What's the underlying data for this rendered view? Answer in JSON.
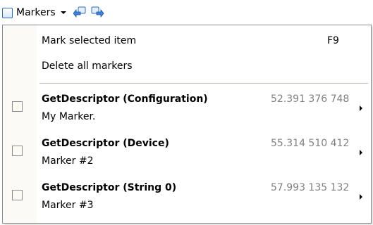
{
  "toolbar": {
    "label": "Markers",
    "icons": [
      "marker-icon",
      "prev-marker-icon",
      "next-marker-icon"
    ]
  },
  "menu": {
    "actions": [
      {
        "label": "Mark selected item",
        "shortcut": "F9"
      },
      {
        "label": "Delete all markers",
        "shortcut": ""
      }
    ],
    "markers": [
      {
        "name": "GetDescriptor (Configuration)",
        "note": "My Marker.",
        "time": "52.391 376 748"
      },
      {
        "name": "GetDescriptor (Device)",
        "note": "Marker #2",
        "time": "55.314 510 412"
      },
      {
        "name": "GetDescriptor (String 0)",
        "note": "Marker #3",
        "time": "57.993 135 132"
      }
    ]
  },
  "colors": {
    "accent": "#2d6ab4",
    "time_text": "#808080",
    "border": "#8c8c8c"
  }
}
